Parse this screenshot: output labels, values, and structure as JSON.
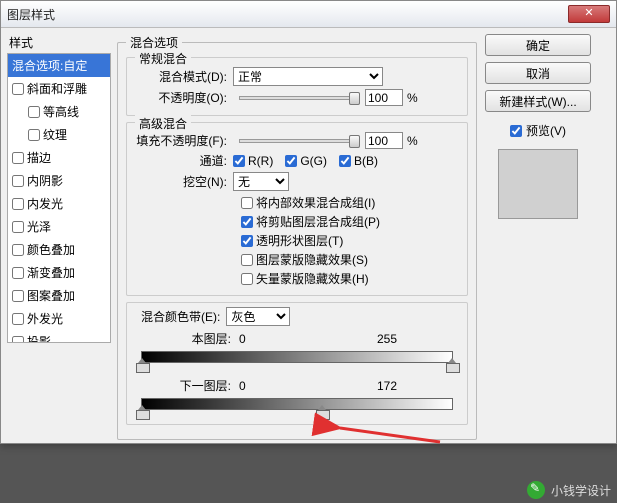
{
  "window": {
    "title": "图层样式"
  },
  "buttons": {
    "ok": "确定",
    "cancel": "取消",
    "new_style": "新建样式(W)...",
    "close_x": "✕"
  },
  "preview": {
    "label": "预览(V)",
    "checked": true
  },
  "left": {
    "title": "样式",
    "items": [
      {
        "label": "混合选项:自定",
        "selected": true,
        "checkbox": false
      },
      {
        "label": "斜面和浮雕",
        "checked": false
      },
      {
        "label": "等高线",
        "checked": false,
        "indent": true
      },
      {
        "label": "纹理",
        "checked": false,
        "indent": true
      },
      {
        "label": "描边",
        "checked": false
      },
      {
        "label": "内阴影",
        "checked": false
      },
      {
        "label": "内发光",
        "checked": false
      },
      {
        "label": "光泽",
        "checked": false
      },
      {
        "label": "颜色叠加",
        "checked": false
      },
      {
        "label": "渐变叠加",
        "checked": false
      },
      {
        "label": "图案叠加",
        "checked": false
      },
      {
        "label": "外发光",
        "checked": false
      },
      {
        "label": "投影",
        "checked": false
      }
    ]
  },
  "center": {
    "legend": "混合选项",
    "general": {
      "legend": "常规混合",
      "mode_label": "混合模式(D):",
      "mode_value": "正常",
      "opacity_label": "不透明度(O):",
      "opacity_value": "100",
      "opacity_unit": "%"
    },
    "advanced": {
      "legend": "高级混合",
      "fill_label": "填充不透明度(F):",
      "fill_value": "100",
      "fill_unit": "%",
      "channels_label": "通道:",
      "ch_r": "R(R)",
      "ch_g": "G(G)",
      "ch_b": "B(B)",
      "knockout_label": "挖空(N):",
      "knockout_value": "无",
      "opts": [
        {
          "label": "将内部效果混合成组(I)",
          "checked": false
        },
        {
          "label": "将剪贴图层混合成组(P)",
          "checked": true
        },
        {
          "label": "透明形状图层(T)",
          "checked": true
        },
        {
          "label": "图层蒙版隐藏效果(S)",
          "checked": false
        },
        {
          "label": "矢量蒙版隐藏效果(H)",
          "checked": false
        }
      ]
    },
    "blendif": {
      "label": "混合颜色带(E):",
      "value": "灰色",
      "this_layer": {
        "label": "本图层:",
        "min": "0",
        "max": "255"
      },
      "under_layer": {
        "label": "下一图层:",
        "min": "0",
        "max": "172"
      }
    }
  },
  "watermark": "小钱学设计"
}
